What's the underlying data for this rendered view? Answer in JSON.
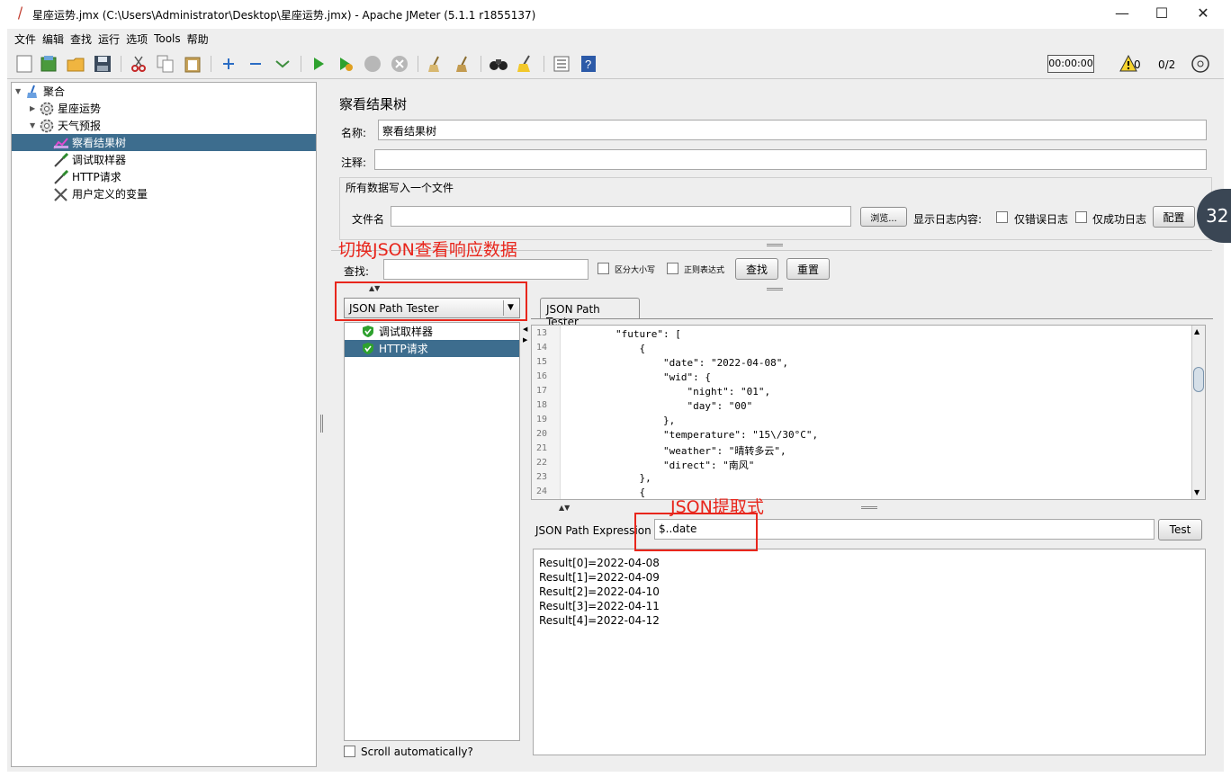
{
  "window": {
    "title": "星座运势.jmx (C:\\Users\\Administrator\\Desktop\\星座运势.jmx) - Apache JMeter (5.1.1 r1855137)",
    "minimize": "—",
    "maximize": "☐",
    "close": "✕"
  },
  "menu": [
    "文件",
    "编辑",
    "查找",
    "运行",
    "选项",
    "Tools",
    "帮助"
  ],
  "toolbar": {
    "timer": "00:00:00",
    "warnings": "0",
    "threads": "0/2"
  },
  "tree": {
    "items": [
      {
        "label": "聚合",
        "icon": "broom-icon"
      },
      {
        "label": "星座运势",
        "icon": "gear-icon"
      },
      {
        "label": "天气预报",
        "icon": "gear-icon"
      },
      {
        "label": "察看结果树",
        "icon": "chart-icon"
      },
      {
        "label": "调试取样器",
        "icon": "pipette-icon"
      },
      {
        "label": "HTTP请求",
        "icon": "pipette-icon"
      },
      {
        "label": "用户定义的变量",
        "icon": "wrench-icon"
      }
    ]
  },
  "panel": {
    "heading": "察看结果树",
    "name_label": "名称:",
    "name_value": "察看结果树",
    "comment_label": "注释:",
    "comment_value": "",
    "file_group_title": "所有数据写入一个文件",
    "file_label": "文件名",
    "file_value": "",
    "browse_label": "浏览...",
    "log_label": "显示日志内容:",
    "errors_only": "仅错误日志",
    "success_only": "仅成功日志",
    "configure": "配置",
    "search_label": "查找:",
    "case_sensitive": "区分大小写",
    "regex": "正则表达式",
    "search_button": "查找",
    "reset_button": "重置",
    "renderer": "JSON Path Tester",
    "samples": [
      "调试取样器",
      "HTTP请求"
    ],
    "scroll_auto": "Scroll automatically?",
    "tab": "JSON Path Tester",
    "expression_label": "JSON Path Expression",
    "expression_value": "$..date",
    "test_button": "Test"
  },
  "code": [
    {
      "n": "13",
      "t": "        \"future\": ["
    },
    {
      "n": "14",
      "t": "            {"
    },
    {
      "n": "15",
      "t": "                \"date\": \"2022-04-08\","
    },
    {
      "n": "16",
      "t": "                \"wid\": {"
    },
    {
      "n": "17",
      "t": "                    \"night\": \"01\","
    },
    {
      "n": "18",
      "t": "                    \"day\": \"00\""
    },
    {
      "n": "19",
      "t": "                },"
    },
    {
      "n": "20",
      "t": "                \"temperature\": \"15\\/30°C\","
    },
    {
      "n": "21",
      "t": "                \"weather\": \"晴转多云\","
    },
    {
      "n": "22",
      "t": "                \"direct\": \"南风\""
    },
    {
      "n": "23",
      "t": "            },"
    },
    {
      "n": "24",
      "t": "            {"
    }
  ],
  "results": [
    "Result[0]=2022-04-08",
    "Result[1]=2022-04-09",
    "Result[2]=2022-04-10",
    "Result[3]=2022-04-11",
    "Result[4]=2022-04-12"
  ],
  "annotations": {
    "switch_json": "切换JSON查看响应数据",
    "json_extract": "JSON提取式"
  },
  "overlay_badge": "32"
}
